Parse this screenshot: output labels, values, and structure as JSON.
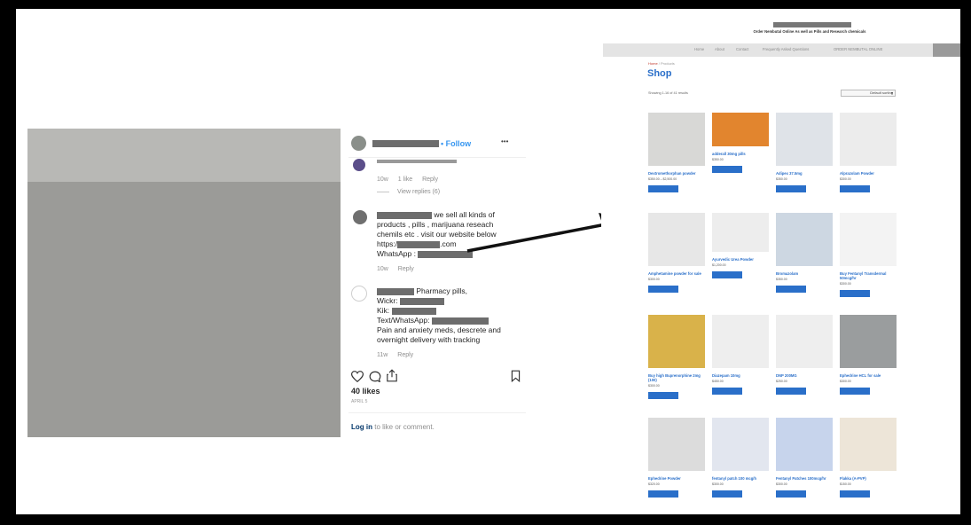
{
  "instagram": {
    "follow_label": "• Follow",
    "more_label": "•••",
    "comments": [
      {
        "name_hidden": true,
        "text_lines": [
          "we sell all kinds of",
          "products , pills , marijuana reseach",
          "chemils etc . visit our website below",
          "https:/",
          ".com",
          "WhatsApp :"
        ],
        "time": "10w",
        "reply": "Reply"
      },
      {
        "name_hidden": true,
        "text_lines": [
          "Pharmacy pills,",
          "Wickr:",
          "Kik:",
          "Text/WhatsApp:",
          "Pain and anxiety meds, descrete and",
          "overnight delivery with tracking"
        ],
        "time": "11w",
        "reply": "Reply"
      }
    ],
    "prev_comment": {
      "time": "10w",
      "likes": "1 like",
      "reply": "Reply",
      "view_replies": "View replies (6)"
    },
    "likes": "40 likes",
    "date": "APRIL 5",
    "login_link": "Log in",
    "login_rest": "to like or comment."
  },
  "shop": {
    "tagline": "Order Nembutal Online As well as Pills and Research chemicals",
    "nav": [
      "Home",
      "About",
      "Contact",
      "Frequently Asked Questions",
      "ORDER NEMBUTAL ONLINE"
    ],
    "breadcrumb_home": "Home",
    "breadcrumb_rest": " / Products",
    "title": "Shop",
    "showing": "Showing 1-16 of 41 results",
    "sort": "Default sorting",
    "products": [
      {
        "name": "Dextromethorphan powder",
        "price": "$350.00 – $2,500.00"
      },
      {
        "name": "adderall 30mg pills",
        "price": "$350.00"
      },
      {
        "name": "Adipex 37.5mg",
        "price": "$350.00"
      },
      {
        "name": "Alprazolam Powder",
        "price": "$300.00"
      },
      {
        "name": "Amphetamine powder for sale",
        "price": "$300.00"
      },
      {
        "name": "Ayurvedic Urea Powder",
        "price": "$1,200.00"
      },
      {
        "name": "Bromazolam",
        "price": "$350.00"
      },
      {
        "name": "Buy Fentanyl Transdermal 50mcg/hr",
        "price": "$300.00"
      },
      {
        "name": "Buy high Buprenorphine 2mg (100)",
        "price": "$300.00"
      },
      {
        "name": "Diazepam 10mg",
        "price": "$450.00"
      },
      {
        "name": "DNP 200MG",
        "price": "$250.00"
      },
      {
        "name": "Ephedrine HCL for sale",
        "price": "$300.00"
      },
      {
        "name": "Ephedrine Powder",
        "price": "$320.00"
      },
      {
        "name": "fentanyl patch 100 mcg/h",
        "price": "$300.00"
      },
      {
        "name": "Fentanyl Patches 100mcg/hr",
        "price": "$300.00"
      },
      {
        "name": "Flakka (A-PVP)",
        "price": "$150.00"
      }
    ],
    "colors": {
      "accent": "#2a6fc9",
      "nav_bg": "#e4e4e4"
    }
  }
}
